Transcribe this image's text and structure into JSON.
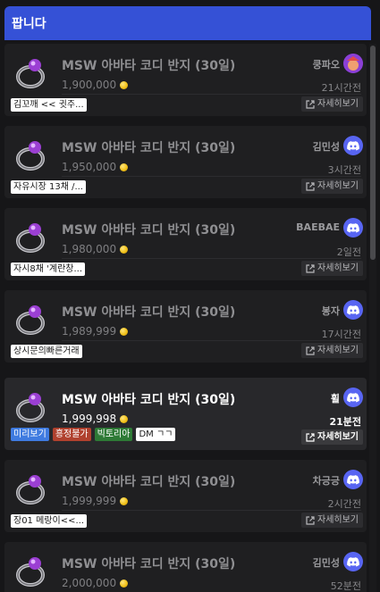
{
  "header": {
    "title": "팝니다"
  },
  "detail_label": "자세히보기",
  "tags": {
    "preview": "미리보기",
    "nodeal": "흥정불가",
    "victoria": "빅토리아"
  },
  "listings": [
    {
      "title": "MSW 아바타 코디 반지 (30일)",
      "seller": "쿵파오",
      "avatar": "custom-avatar",
      "price": "1,900,000",
      "time": "21시간전",
      "comment": "김꼬깨 << 귓주..."
    },
    {
      "title": "MSW 아바타 코디 반지 (30일)",
      "seller": "김민성",
      "avatar": "discord-icon",
      "price": "1,950,000",
      "time": "3시간전",
      "comment": "자유시장 13채 /..."
    },
    {
      "title": "MSW 아바타 코디 반지 (30일)",
      "seller": "BAEBAE",
      "avatar": "discord-icon",
      "price": "1,980,000",
      "time": "2일전",
      "comment": "자시8채 '계란창..."
    },
    {
      "title": "MSW 아바타 코디 반지 (30일)",
      "seller": "봉자",
      "avatar": "discord-icon",
      "price": "1,989,999",
      "time": "17시간전",
      "comment": "상시문의빠른거래"
    },
    {
      "title": "MSW 아바타 코디 반지 (30일)",
      "seller": "휠",
      "avatar": "discord-icon",
      "price": "1,999,998",
      "time": "21분전",
      "comment": "DM ㄱㄱ",
      "active": true
    },
    {
      "title": "MSW 아바타 코디 반지 (30일)",
      "seller": "차긍긍",
      "avatar": "discord-icon",
      "price": "1,999,999",
      "time": "2시간전",
      "comment": "장01 메랑이<<..."
    },
    {
      "title": "MSW 아바타 코디 반지 (30일)",
      "seller": "김민성",
      "avatar": "discord-icon",
      "price": "2,000,000",
      "time": "52분전",
      "comment": ""
    }
  ]
}
